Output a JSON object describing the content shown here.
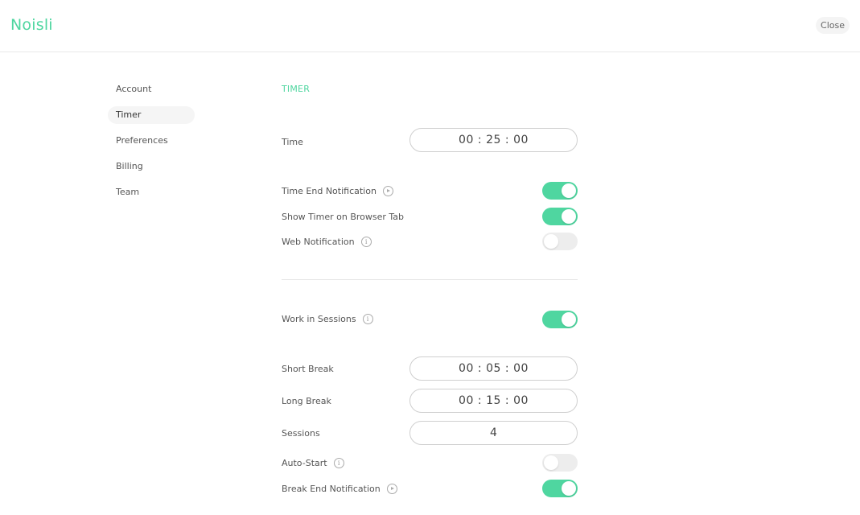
{
  "header": {
    "logo": "Noisli",
    "close_label": "Close",
    "accent_color": "#4fd6a0"
  },
  "sidebar": {
    "items": [
      {
        "label": "Account",
        "active": false
      },
      {
        "label": "Timer",
        "active": true
      },
      {
        "label": "Preferences",
        "active": false
      },
      {
        "label": "Billing",
        "active": false
      },
      {
        "label": "Team",
        "active": false
      }
    ]
  },
  "main": {
    "section_title": "TIMER",
    "time": {
      "label": "Time",
      "hours": "00",
      "minutes": "25",
      "seconds": "00"
    },
    "time_end_notification": {
      "label": "Time End Notification",
      "icon": "play-icon",
      "enabled": true
    },
    "show_timer_tab": {
      "label": "Show Timer on Browser Tab",
      "enabled": true
    },
    "web_notification": {
      "label": "Web Notification",
      "icon": "info-icon",
      "enabled": false
    },
    "work_in_sessions": {
      "label": "Work in Sessions",
      "icon": "info-icon",
      "enabled": true
    },
    "short_break": {
      "label": "Short Break",
      "hours": "00",
      "minutes": "05",
      "seconds": "00"
    },
    "long_break": {
      "label": "Long Break",
      "hours": "00",
      "minutes": "15",
      "seconds": "00"
    },
    "sessions": {
      "label": "Sessions",
      "value": "4"
    },
    "auto_start": {
      "label": "Auto-Start",
      "icon": "info-icon",
      "enabled": false
    },
    "break_end_notification": {
      "label": "Break End Notification",
      "icon": "play-icon",
      "enabled": true
    },
    "time_separator": ":"
  }
}
